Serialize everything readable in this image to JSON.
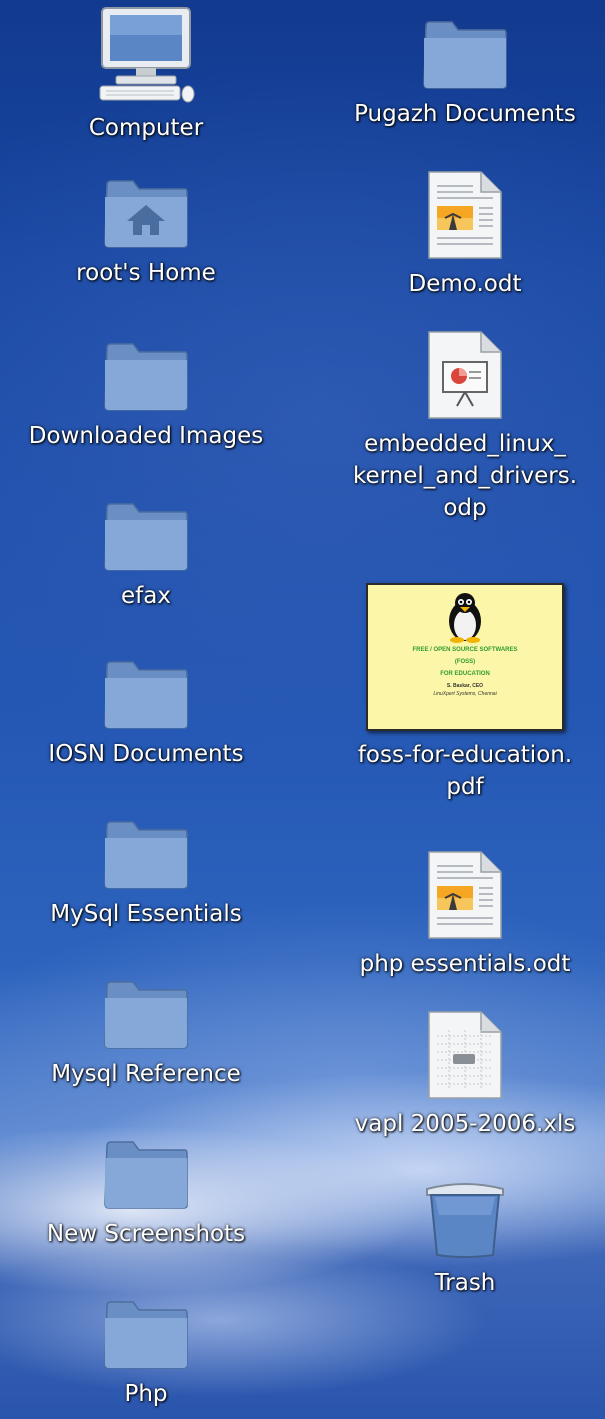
{
  "desktop": {
    "left_column": [
      {
        "label": "Computer",
        "icon": "computer-icon"
      },
      {
        "label": "root's Home",
        "icon": "home-folder-icon"
      },
      {
        "label": "Downloaded Images",
        "icon": "folder-icon"
      },
      {
        "label": "efax",
        "icon": "folder-icon"
      },
      {
        "label": "IOSN Documents",
        "icon": "folder-icon"
      },
      {
        "label": "MySql Essentials",
        "icon": "folder-icon"
      },
      {
        "label": "Mysql Reference",
        "icon": "folder-icon"
      },
      {
        "label": "New Screenshots",
        "icon": "folder-icon"
      },
      {
        "label": "Php",
        "icon": "folder-icon"
      }
    ],
    "right_column": [
      {
        "label": "Pugazh Documents",
        "icon": "folder-icon"
      },
      {
        "label": "Demo.odt",
        "icon": "odt-document-icon"
      },
      {
        "label": "embedded_linux_\nkernel_and_drivers.\nodp",
        "icon": "odp-presentation-icon"
      },
      {
        "label": "foss-for-education.\npdf",
        "icon": "pdf-thumbnail-icon"
      },
      {
        "label": "php essentials.odt",
        "icon": "odt-document-icon"
      },
      {
        "label": "vapl 2005-2006.xls",
        "icon": "spreadsheet-icon"
      },
      {
        "label": "Trash",
        "icon": "trash-icon"
      }
    ],
    "pdf_thumbnail": {
      "line1": "FREE / OPEN SOURCE SOFTWARES",
      "line2": "(FOSS)",
      "line3": "FOR EDUCATION",
      "line4": "S. Baskar, CEO",
      "line5": "LinuXpert Systems, Chennai"
    }
  }
}
